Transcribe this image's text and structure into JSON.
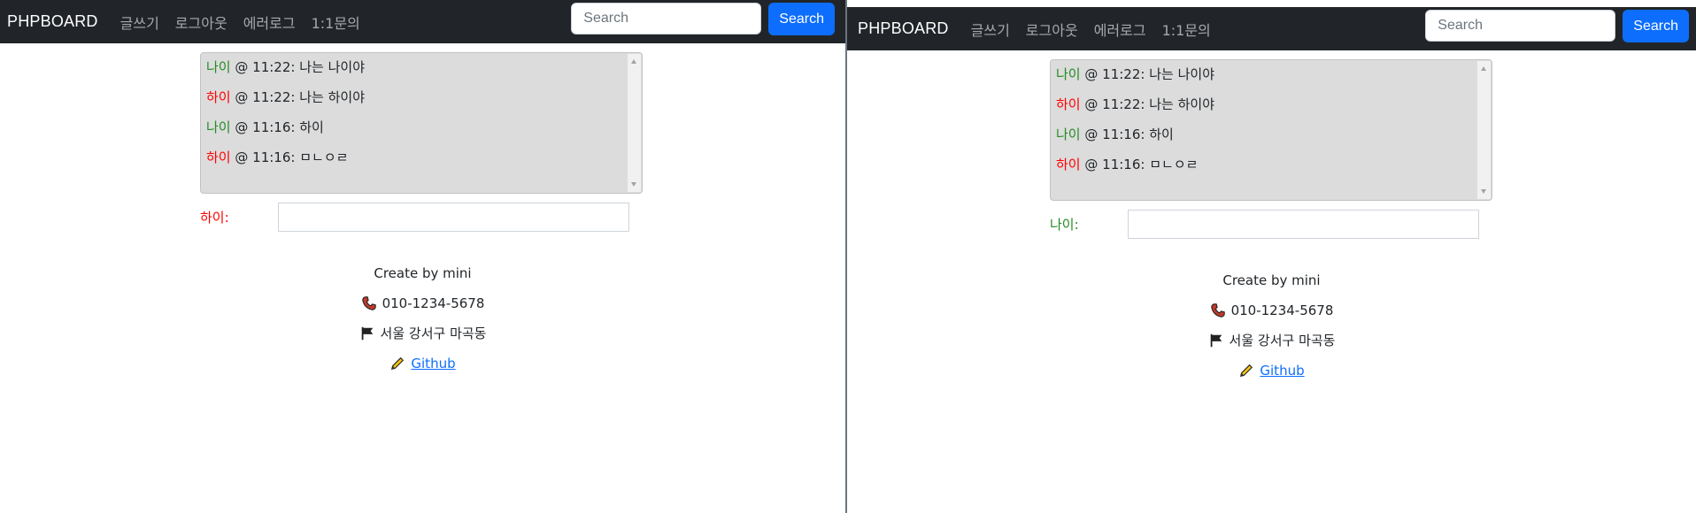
{
  "navbar": {
    "brand": "PHPBOARD",
    "links": [
      "글쓰기",
      "로그아웃",
      "에러로그",
      "1:1문의"
    ],
    "search_placeholder": "Search",
    "search_button": "Search"
  },
  "panels": [
    {
      "messages": [
        {
          "user": "나이",
          "time": "@ 11:22:",
          "text": "나는 나이야",
          "color": "#228b22"
        },
        {
          "user": "하이",
          "time": "@ 11:22:",
          "text": "나는 하이야",
          "color": "#ff0000"
        },
        {
          "user": "나이",
          "time": "@ 11:16:",
          "text": "하이",
          "color": "#228b22"
        },
        {
          "user": "하이",
          "time": "@ 11:16:",
          "text": "ㅁㄴㅇㄹ",
          "color": "#ff0000"
        }
      ],
      "input_label": "하이:",
      "input_label_color": "#ff0000"
    },
    {
      "messages": [
        {
          "user": "나이",
          "time": "@ 11:22:",
          "text": "나는 나이야",
          "color": "#228b22"
        },
        {
          "user": "하이",
          "time": "@ 11:22:",
          "text": "나는 하이야",
          "color": "#ff0000"
        },
        {
          "user": "나이",
          "time": "@ 11:16:",
          "text": "하이",
          "color": "#228b22"
        },
        {
          "user": "하이",
          "time": "@ 11:16:",
          "text": "ㅁㄴㅇㄹ",
          "color": "#ff0000"
        }
      ],
      "input_label": "나이:",
      "input_label_color": "#228b22"
    }
  ],
  "footer": {
    "credit": "Create by mini",
    "phone": "010-1234-5678",
    "address": "서울 강서구 마곡동",
    "github": "Github",
    "icons": [
      "phone-icon",
      "flag-icon",
      "pencil-icon"
    ]
  },
  "colors": {
    "navbar_bg": "#212529",
    "accent": "#0d6efd",
    "chat_bg": "#dcdcdc"
  }
}
